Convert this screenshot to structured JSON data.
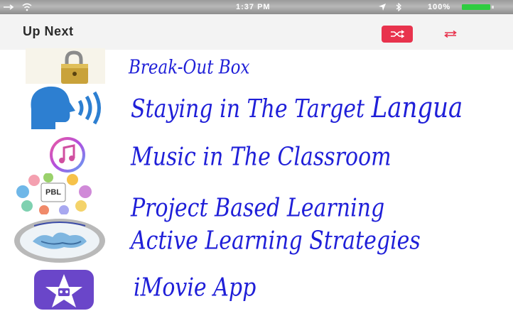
{
  "status_bar": {
    "time": "1:37 PM",
    "battery_text": "100%",
    "battery_level": 1.0,
    "left_icons": [
      "usb-icon",
      "wifi-icon"
    ],
    "right_icons": [
      "location-icon",
      "bluetooth-icon"
    ]
  },
  "header": {
    "title": "Up Next",
    "shuffle_icon": "shuffle-icon",
    "repeat_icon": "repeat-icon",
    "accent_color": "#e8334d"
  },
  "queue": [
    {
      "title": "Break-Out Box",
      "icon": "padlock-icon"
    },
    {
      "title": "Staying in The Target Langua",
      "title_emphasis": "Langua",
      "icon": "speaking-head-icon"
    },
    {
      "title": "Music in The Classroom",
      "icon": "itunes-music-icon"
    },
    {
      "title": "Project Based Learning",
      "icon": "pbl-diagram-icon"
    },
    {
      "title": "Active Learning Strategies",
      "icon": "active-learning-logo-icon"
    },
    {
      "title": "iMovie App",
      "icon": "imovie-star-icon"
    }
  ],
  "colors": {
    "title_text": "#1f1fd8",
    "status_bar": "#9a9a9a",
    "header_bg": "#f3f3f3"
  }
}
